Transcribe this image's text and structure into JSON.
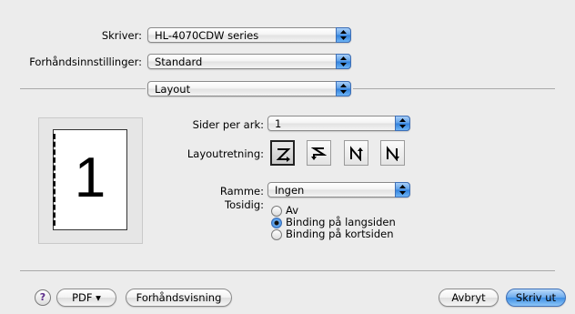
{
  "printer": {
    "label": "Skriver:",
    "value": "HL-4070CDW series"
  },
  "presets": {
    "label": "Forhåndsinnstillinger:",
    "value": "Standard"
  },
  "panel": {
    "value": "Layout"
  },
  "layout": {
    "pages_per_sheet": {
      "label": "Sider per ark:",
      "value": "1"
    },
    "direction": {
      "label": "Layoutretning:",
      "options": [
        "Z",
        "S",
        "И",
        "N"
      ],
      "selected_index": 0
    },
    "border": {
      "label": "Ramme:",
      "value": "Ingen"
    },
    "two_sided": {
      "label": "Tosidig:",
      "options": [
        "Av",
        "Binding på langsiden",
        "Binding på kortsiden"
      ],
      "selected_index": 1
    }
  },
  "preview": {
    "page_number": "1"
  },
  "buttons": {
    "help": "?",
    "pdf": "PDF ▾",
    "preview": "Forhåndsvisning",
    "cancel": "Avbryt",
    "print": "Skriv ut"
  }
}
